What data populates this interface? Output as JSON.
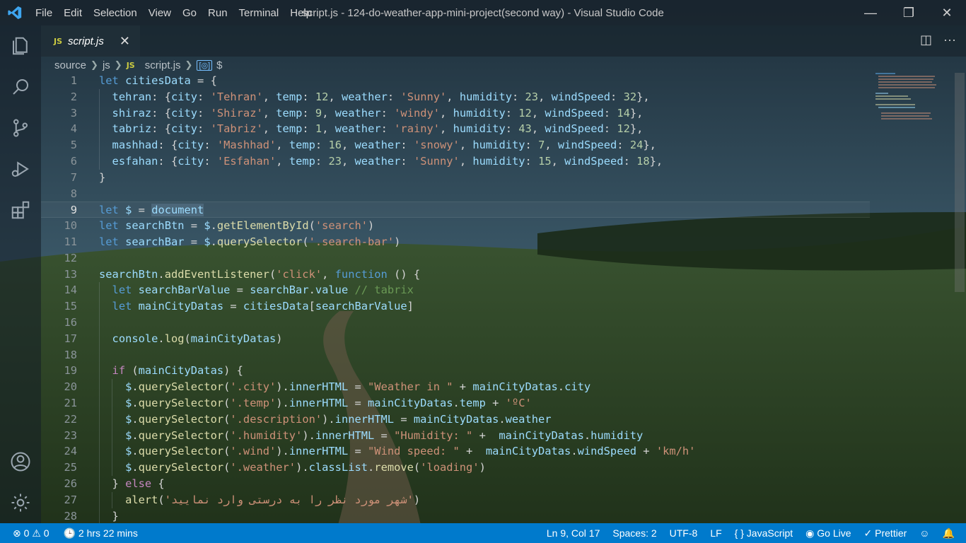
{
  "window": {
    "title": "script.js - 124-do-weather-app-mini-project(second way) - Visual Studio Code",
    "minimize": "—",
    "restore": "❐",
    "close": "✕"
  },
  "menu": [
    "File",
    "Edit",
    "Selection",
    "View",
    "Go",
    "Run",
    "Terminal",
    "Help"
  ],
  "tab": {
    "badge": "JS",
    "label": "script.js",
    "close": "✕"
  },
  "editor_actions": {
    "split": "◫",
    "more": "···"
  },
  "breadcrumb": {
    "parts": [
      "source",
      "js"
    ],
    "file_badge": "JS",
    "file": "script.js",
    "symbol_badge": "[◎]",
    "symbol": "$"
  },
  "code_lines": [
    {
      "n": "1"
    },
    {
      "n": "2"
    },
    {
      "n": "3"
    },
    {
      "n": "4"
    },
    {
      "n": "5"
    },
    {
      "n": "6"
    },
    {
      "n": "7"
    },
    {
      "n": "8"
    },
    {
      "n": "9"
    },
    {
      "n": "10"
    },
    {
      "n": "11"
    },
    {
      "n": "12"
    },
    {
      "n": "13"
    },
    {
      "n": "14"
    },
    {
      "n": "15"
    },
    {
      "n": "16"
    },
    {
      "n": "17"
    },
    {
      "n": "18"
    },
    {
      "n": "19"
    },
    {
      "n": "20"
    },
    {
      "n": "21"
    },
    {
      "n": "22"
    },
    {
      "n": "23"
    },
    {
      "n": "24"
    },
    {
      "n": "25"
    },
    {
      "n": "26"
    },
    {
      "n": "27"
    },
    {
      "n": "28"
    }
  ],
  "code": {
    "l1": [
      "let",
      " citiesData ",
      "=",
      " {"
    ],
    "rows": [
      {
        "key": "tehran",
        "city": "'Tehran'",
        "temp": "12",
        "weather": "'Sunny'",
        "humidity": "23",
        "wind": "32"
      },
      {
        "key": "shiraz",
        "city": "'Shiraz'",
        "temp": "9",
        "weather": "'windy'",
        "humidity": "12",
        "wind": "14"
      },
      {
        "key": "tabriz",
        "city": "'Tabriz'",
        "temp": "1",
        "weather": "'rainy'",
        "humidity": "43",
        "wind": "12"
      },
      {
        "key": "mashhad",
        "city": "'Mashhad'",
        "temp": "16",
        "weather": "'snowy'",
        "humidity": "7",
        "wind": "24"
      },
      {
        "key": "esfahan",
        "city": "'Esfahan'",
        "temp": "23",
        "weather": "'Sunny'",
        "humidity": "15",
        "wind": "18"
      }
    ],
    "l20_str": "\"Weather in \"",
    "l21_str": "'ºC'",
    "l23_str": "\"Humidity: \"",
    "l24_str": "\"Wind speed: \"",
    "l24_unit": "'km/h'",
    "l27_str": "'شهر مورد نظر را به درستی وارد نمایید'",
    "l14_comment": "// tabrix"
  },
  "status": {
    "errors": "0",
    "warnings": "0",
    "time": "2 hrs 22 mins",
    "position": "Ln 9, Col 17",
    "spaces": "Spaces: 2",
    "encoding": "UTF-8",
    "eol": "LF",
    "language": "JavaScript",
    "golive": "Go Live",
    "prettier": "Prettier"
  },
  "colors": {
    "statusbar": "#007acc",
    "keyword": "#569cd6",
    "string": "#ce9178",
    "number": "#b5cea8",
    "variable": "#9cdcfe",
    "function": "#dcdcaa",
    "comment": "#6a9955"
  }
}
